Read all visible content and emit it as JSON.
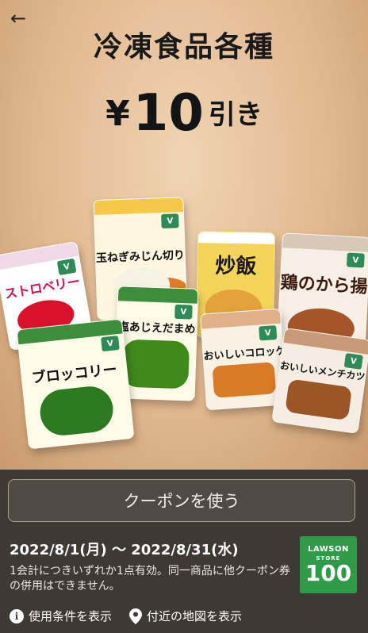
{
  "nav": {
    "back_glyph": "←",
    "back_icon": "arrow-left-icon"
  },
  "promo": {
    "title": "冷凍食品各種",
    "discount_currency": "¥",
    "discount_amount": "10",
    "discount_suffix": "引き"
  },
  "products": [
    {
      "id": "tamanegi",
      "label": "玉ねぎみじん切り"
    },
    {
      "id": "chahan",
      "label": "炒飯"
    },
    {
      "id": "karaage",
      "label": "鶏のから揚げ"
    },
    {
      "id": "strawberry",
      "label": "ストロベリー"
    },
    {
      "id": "edamame",
      "label": "塩あじえだまめ"
    },
    {
      "id": "croquette",
      "label": "おいしいコロッケ"
    },
    {
      "id": "mince",
      "label": "おいしいメンチカツ"
    },
    {
      "id": "broccoli",
      "label": "ブロッコリー"
    }
  ],
  "coupon": {
    "use_button_label": "クーポンを使う",
    "period": "2022/8/1(月) 〜 2022/8/31(水)",
    "notice": "1会計につきいずれか1点有効。同一商品に他クーポン券の併用はできません。"
  },
  "store_logo": {
    "line1": "LAWSON",
    "line2": "STORE",
    "line3": "100",
    "color": "#2f9b49"
  },
  "links": {
    "terms_label": "使用条件を表示",
    "terms_icon": "info-icon",
    "map_label": "付近の地図を表示",
    "map_icon": "map-pin-icon"
  },
  "colors": {
    "panel_bg": "#3f3934",
    "button_bg": "#514a44",
    "button_border": "#a9a29a"
  }
}
